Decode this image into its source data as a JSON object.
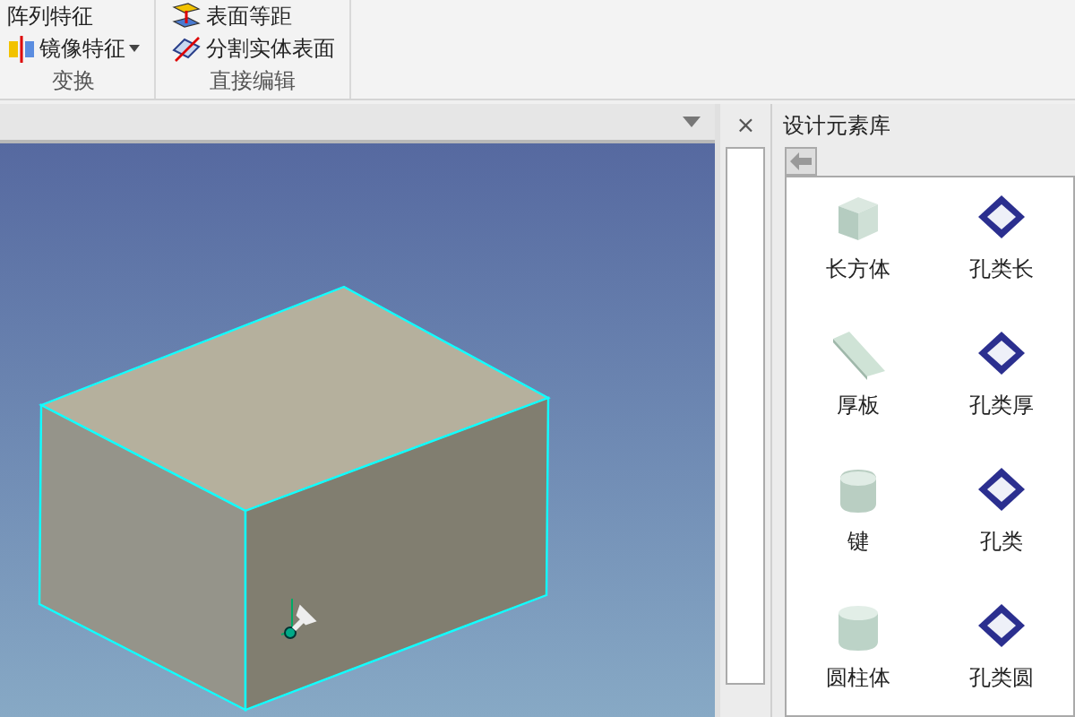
{
  "ribbon": {
    "groups": [
      {
        "label": "变换",
        "commands": [
          {
            "label": "阵列特征",
            "kind": "array",
            "dropdown": false
          },
          {
            "label": "镜像特征",
            "kind": "mirror",
            "dropdown": true
          }
        ]
      },
      {
        "label": "直接编辑",
        "commands": [
          {
            "label": "表面等距",
            "kind": "offset",
            "dropdown": false
          },
          {
            "label": "分割实体表面",
            "kind": "split",
            "dropdown": false
          }
        ]
      }
    ]
  },
  "side_pane": {
    "close": "×"
  },
  "library": {
    "title": "设计元素库",
    "items": [
      {
        "label": "长方体",
        "kind": "solid"
      },
      {
        "label": "孔类长",
        "kind": "hole"
      },
      {
        "label": "厚板",
        "kind": "plate"
      },
      {
        "label": "孔类厚",
        "kind": "hole"
      },
      {
        "label": "键",
        "kind": "key"
      },
      {
        "label": "孔类",
        "kind": "hole"
      },
      {
        "label": "圆柱体",
        "kind": "cylinder"
      },
      {
        "label": "孔类圆",
        "kind": "hole"
      }
    ]
  }
}
